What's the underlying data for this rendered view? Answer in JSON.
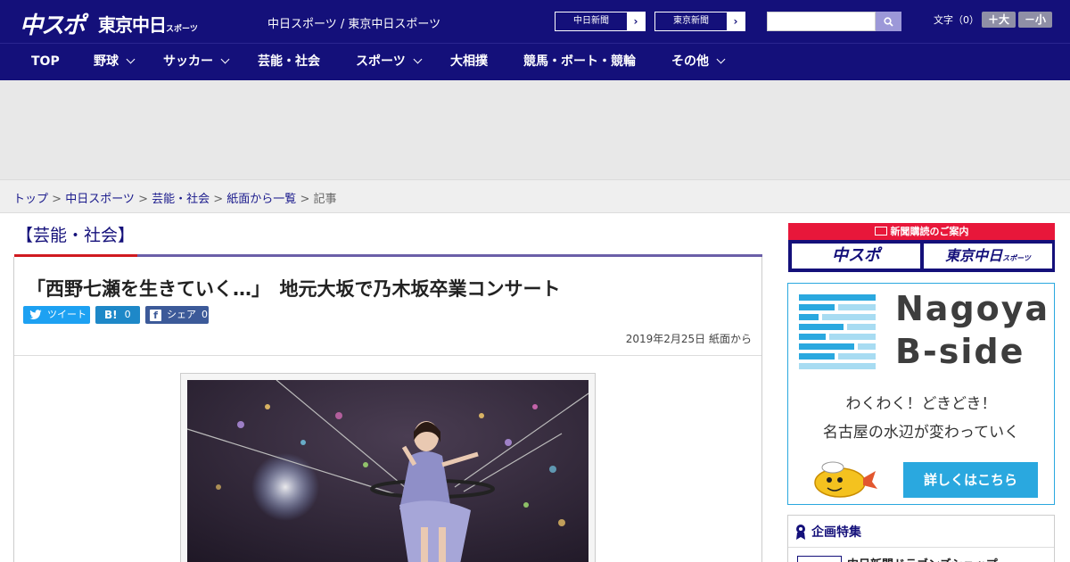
{
  "header": {
    "logo_chuspo": "中スポ",
    "logo_tokyo": "東京中日",
    "logo_tokyo_small": "スポーツ",
    "site_subtitle": "中日スポーツ / 東京中日スポーツ",
    "paper_links": [
      {
        "label": "中日新聞"
      },
      {
        "label": "東京新聞"
      }
    ],
    "search_placeholder": "",
    "font_size_label": "文字（0）",
    "font_bigger": "＋大",
    "font_smaller": "－小"
  },
  "nav": {
    "items": [
      {
        "label": "TOP"
      },
      {
        "label": "野球"
      },
      {
        "label": "サッカー"
      },
      {
        "label": "芸能・社会"
      },
      {
        "label": "スポーツ"
      },
      {
        "label": "大相撲"
      },
      {
        "label": "競馬・ボート・競輪"
      },
      {
        "label": "その他"
      }
    ]
  },
  "breadcrumb": {
    "items": [
      "トップ",
      "中日スポーツ",
      "芸能・社会",
      "紙面から一覧"
    ],
    "current": "記事"
  },
  "article": {
    "category": "【芸能・社会】",
    "headline": "「西野七瀬を生きていく…」　地元大坂で乃木坂卒業コンサート",
    "share": {
      "tweet": "ツイート",
      "hatena": "B!",
      "hatena_count": "0",
      "facebook": "シェア",
      "facebook_count": "0"
    },
    "date": "2019年2月25日 紙面から"
  },
  "sidebar": {
    "subscribe": {
      "title": "新聞購読のご案内",
      "chuspo": "中スポ",
      "tokyo": "東京中日",
      "tokyo_small": "スポーツ"
    },
    "bside": {
      "title_line1": "Nagoya",
      "title_line2": "B-side",
      "copy1": "わくわく！どきどき！",
      "copy2": "名古屋の水辺が変わっていく",
      "button": "詳しくはこちら"
    },
    "feature": {
      "title": "企画特集",
      "item": "中日新聞ドラゴンズショップ"
    }
  },
  "colors": {
    "header_bg": "#14107a",
    "accent_red": "#d01a20",
    "accent_purple": "#6b5fa8",
    "bside_blue": "#2aa8df"
  }
}
